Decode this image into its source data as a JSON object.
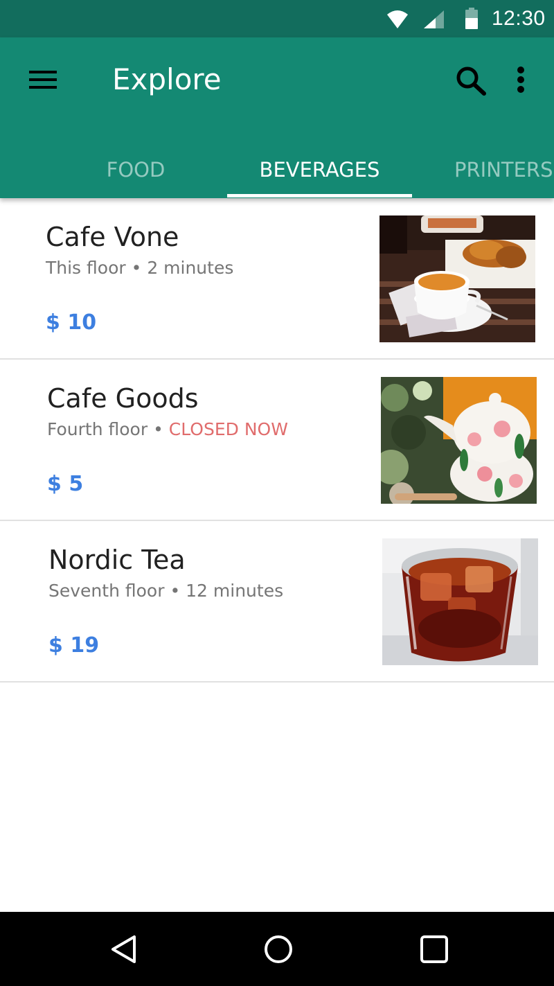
{
  "status_bar": {
    "time": "12:30",
    "icons": [
      "wifi-icon",
      "signal-icon",
      "battery-icon"
    ]
  },
  "app_bar": {
    "title": "Explore",
    "icons": [
      "menu-icon",
      "search-icon",
      "more-vert-icon"
    ],
    "background": "#148973"
  },
  "tabs": [
    {
      "label": "FOOD",
      "selected": false
    },
    {
      "label": "BEVERAGES",
      "selected": true
    },
    {
      "label": "PRINTERS",
      "selected": false
    }
  ],
  "places": [
    {
      "name": "Cafe Vone",
      "location": "This floor",
      "separator": "•",
      "detail": "2 minutes",
      "price": "$ 10",
      "image": "coffee-croissant-photo"
    },
    {
      "name": "Cafe Goods",
      "location": "Fourth floor",
      "separator": "•",
      "detail": "CLOSED NOW",
      "price": "$ 5",
      "image": "floral-teapot-photo"
    },
    {
      "name": "Nordic Tea",
      "location": "Seventh floor",
      "separator": "•",
      "detail": "12 minutes",
      "price": "$ 19",
      "image": "iced-tea-photo"
    }
  ],
  "colors": {
    "status_bar": "#126d5d",
    "accent": "#148973",
    "price": "#3d7fe0",
    "closed": "#e06c6c"
  },
  "nav_bar": {
    "icons": [
      "back-icon",
      "home-icon",
      "recents-icon"
    ]
  }
}
